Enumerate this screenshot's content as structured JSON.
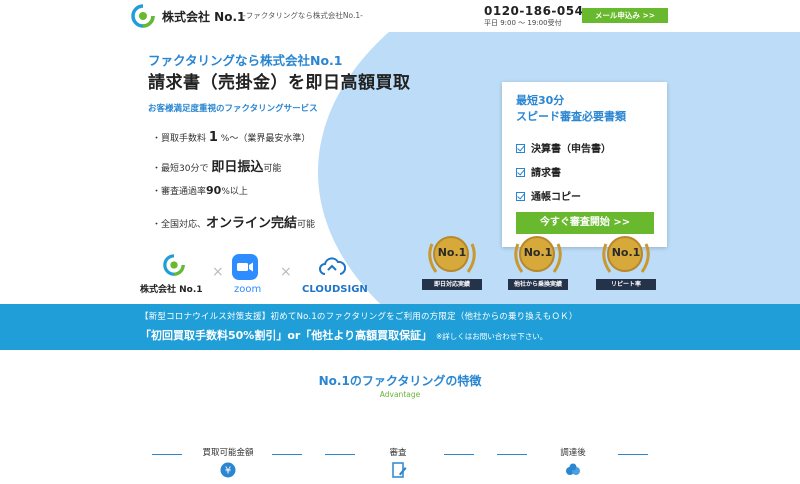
{
  "header": {
    "company": "株式会社 No.1",
    "tagline": "-ファクタリングなら株式会社No.1-",
    "phone": "0120-186-054",
    "hours": "平日 9:00 〜 19:00受付",
    "mail_button": "メール申込み >>"
  },
  "hero": {
    "subtitle": "ファクタリングなら株式会社No.1",
    "title": "請求書（売掛金）を即日高額買取",
    "note": "お客様満足度重視のファクタリングサービス",
    "bullets": [
      {
        "pre": "・買取手数料 ",
        "bold": "1",
        "post": " %〜（業界最安水準）"
      },
      {
        "pre": "・最短30分で ",
        "bold": "即日振込",
        "post": "可能"
      },
      {
        "pre": "・審査通過率",
        "bold": "90",
        "post": "%以上"
      },
      {
        "pre": "・全国対応、",
        "bold": "オンライン完結",
        "post": "可能"
      }
    ],
    "partners": {
      "company": "株式会社 No.1",
      "zoom": "zoom",
      "cloudsign": "CLOUDSIGN",
      "times": "×"
    }
  },
  "card": {
    "title1": "最短30分",
    "title2": "スピード審査必要書類",
    "items": [
      "決算書（申告書）",
      "請求書",
      "通帳コピー"
    ],
    "button": "今すぐ審査開始 >>"
  },
  "medals": [
    {
      "num": "No.1",
      "label": "即日対応実績"
    },
    {
      "num": "No.1",
      "label": "他社から乗換実績"
    },
    {
      "num": "No.1",
      "label": "リピート率"
    }
  ],
  "band": {
    "line1": "【新型コロナウイルス対策支援】初めてNo.1のファクタリングをご利用の方限定（他社からの乗り換えもＯＫ）",
    "line2": "「初回買取手数料50%割引」or「他社より高額買取保証」",
    "line2_small": "※詳しくはお問い合わせ下さい。"
  },
  "features": {
    "title": "No.1のファクタリングの特徴",
    "subtitle": "Advantage",
    "columns": [
      "買取可能金額",
      "審査",
      "調達後"
    ]
  },
  "colors": {
    "blue": "#2a86d1",
    "green": "#68b92e",
    "band": "#1f9ed8",
    "hero_bg": "#bcdcf7"
  }
}
